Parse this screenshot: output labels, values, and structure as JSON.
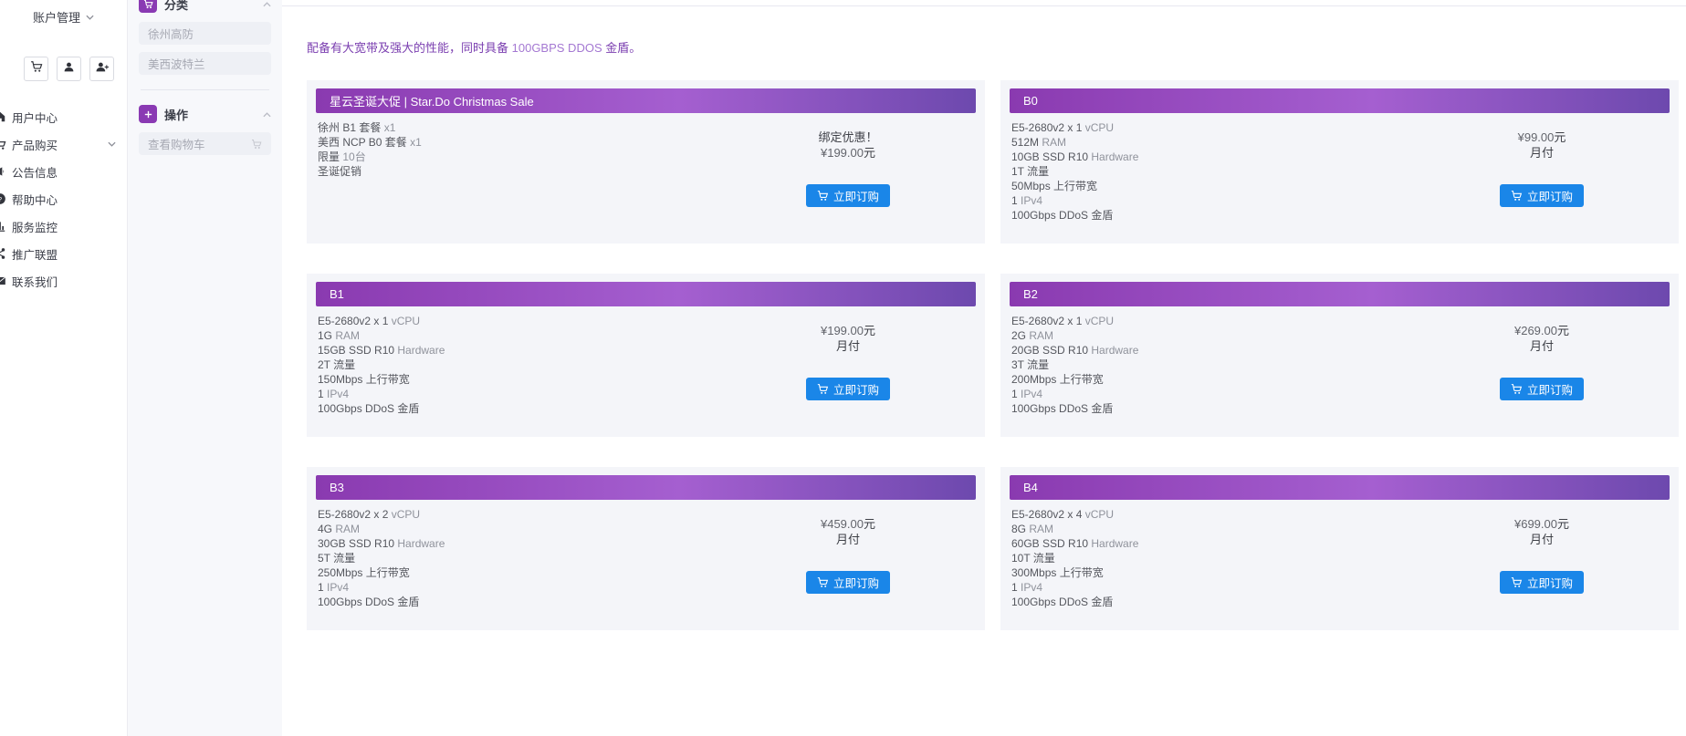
{
  "sidebar": {
    "account_label": "账户管理",
    "icon_buttons": [
      {
        "icon": "cart-icon"
      },
      {
        "icon": "user-icon"
      },
      {
        "icon": "user-plus-icon"
      }
    ],
    "nav": [
      {
        "label": "用户中心",
        "icon": "home-icon"
      },
      {
        "label": "产品购买",
        "icon": "cart-icon",
        "expanded": true
      },
      {
        "label": "公告信息",
        "icon": "bullhorn-icon"
      },
      {
        "label": "帮助中心",
        "icon": "question-circle-icon"
      },
      {
        "label": "服务监控",
        "icon": "monitor-icon"
      },
      {
        "label": "推广联盟",
        "icon": "share-icon"
      },
      {
        "label": "联系我们",
        "icon": "envelope-icon"
      }
    ]
  },
  "panel": {
    "category_section": {
      "title": "分类",
      "icon": "cart-icon",
      "items": [
        {
          "label": "徐州高防"
        },
        {
          "label": "美西波特兰"
        }
      ]
    },
    "action_section": {
      "title": "操作",
      "icon": "plus-icon",
      "items": [
        {
          "label": "查看购物车",
          "right_icon": "cart-icon"
        }
      ]
    }
  },
  "main": {
    "intro": {
      "part1": "配备有大宽带及强大的性能，同时具备 ",
      "part2": "100GBPS DDOS",
      "part3": " 金盾。"
    },
    "cards": [
      {
        "title": "星云圣诞大促 | Star.Do Christmas Sale",
        "specs": [
          {
            "b": "徐州 B1 套餐",
            "t": " x1"
          },
          {
            "b": "美西 NCP B0 套餐",
            "t": " x1"
          },
          {
            "b": "限量",
            "t": " 10台"
          },
          {
            "b": "圣诞促销",
            "t": ""
          }
        ],
        "promo": "绑定优惠！",
        "amount": "¥199.00",
        "unit": "元",
        "cycle": "",
        "button": "立即订购"
      },
      {
        "title": "B0",
        "specs": [
          {
            "b": "E5-2680v2 x 1",
            "t": " vCPU"
          },
          {
            "b": "512M",
            "t": " RAM"
          },
          {
            "b": "10GB SSD R10",
            "t": " Hardware"
          },
          {
            "b": "1T 流量",
            "t": ""
          },
          {
            "b": "50Mbps 上行带宽",
            "t": ""
          },
          {
            "b": "1",
            "t": " IPv4"
          },
          {
            "b": "100Gbps DDoS 金盾",
            "t": ""
          }
        ],
        "amount": "¥99.00",
        "unit": "元",
        "cycle": "月付",
        "button": "立即订购"
      },
      {
        "title": "B1",
        "specs": [
          {
            "b": "E5-2680v2 x 1",
            "t": " vCPU"
          },
          {
            "b": "1G",
            "t": " RAM"
          },
          {
            "b": "15GB SSD R10",
            "t": " Hardware"
          },
          {
            "b": "2T 流量",
            "t": ""
          },
          {
            "b": "150Mbps 上行带宽",
            "t": ""
          },
          {
            "b": "1",
            "t": " IPv4"
          },
          {
            "b": "100Gbps DDoS 金盾",
            "t": ""
          }
        ],
        "amount": "¥199.00",
        "unit": "元",
        "cycle": "月付",
        "button": "立即订购"
      },
      {
        "title": "B2",
        "specs": [
          {
            "b": "E5-2680v2 x 1",
            "t": " vCPU"
          },
          {
            "b": "2G",
            "t": " RAM"
          },
          {
            "b": "20GB SSD R10",
            "t": " Hardware"
          },
          {
            "b": "3T 流量",
            "t": ""
          },
          {
            "b": "200Mbps 上行带宽",
            "t": ""
          },
          {
            "b": "1",
            "t": " IPv4"
          },
          {
            "b": "100Gbps DDoS 金盾",
            "t": ""
          }
        ],
        "amount": "¥269.00",
        "unit": "元",
        "cycle": "月付",
        "button": "立即订购"
      },
      {
        "title": "B3",
        "specs": [
          {
            "b": "E5-2680v2 x 2",
            "t": " vCPU"
          },
          {
            "b": "4G",
            "t": " RAM"
          },
          {
            "b": "30GB SSD R10",
            "t": " Hardware"
          },
          {
            "b": "5T 流量",
            "t": ""
          },
          {
            "b": "250Mbps 上行带宽",
            "t": ""
          },
          {
            "b": "1",
            "t": " IPv4"
          },
          {
            "b": "100Gbps DDoS 金盾",
            "t": ""
          }
        ],
        "amount": "¥459.00",
        "unit": "元",
        "cycle": "月付",
        "button": "立即订购"
      },
      {
        "title": "B4",
        "specs": [
          {
            "b": "E5-2680v2 x 4",
            "t": " vCPU"
          },
          {
            "b": "8G",
            "t": " RAM"
          },
          {
            "b": "60GB SSD R10",
            "t": " Hardware"
          },
          {
            "b": "10T 流量",
            "t": ""
          },
          {
            "b": "300Mbps 上行带宽",
            "t": ""
          },
          {
            "b": "1",
            "t": " IPv4"
          },
          {
            "b": "100Gbps DDoS 金盾",
            "t": ""
          }
        ],
        "amount": "¥699.00",
        "unit": "元",
        "cycle": "月付",
        "button": "立即订购"
      }
    ]
  },
  "colors": {
    "accent_purple": "#8a3ab3",
    "header_gradient_start": "#8a3ab0",
    "header_gradient_mid": "#a55fd0",
    "header_gradient_end": "#6d49ae",
    "button_blue": "#1a86e8",
    "card_background": "#f4f5f9",
    "panel_background": "#f7f8fb",
    "intro_purple": "#7b3fb0"
  }
}
